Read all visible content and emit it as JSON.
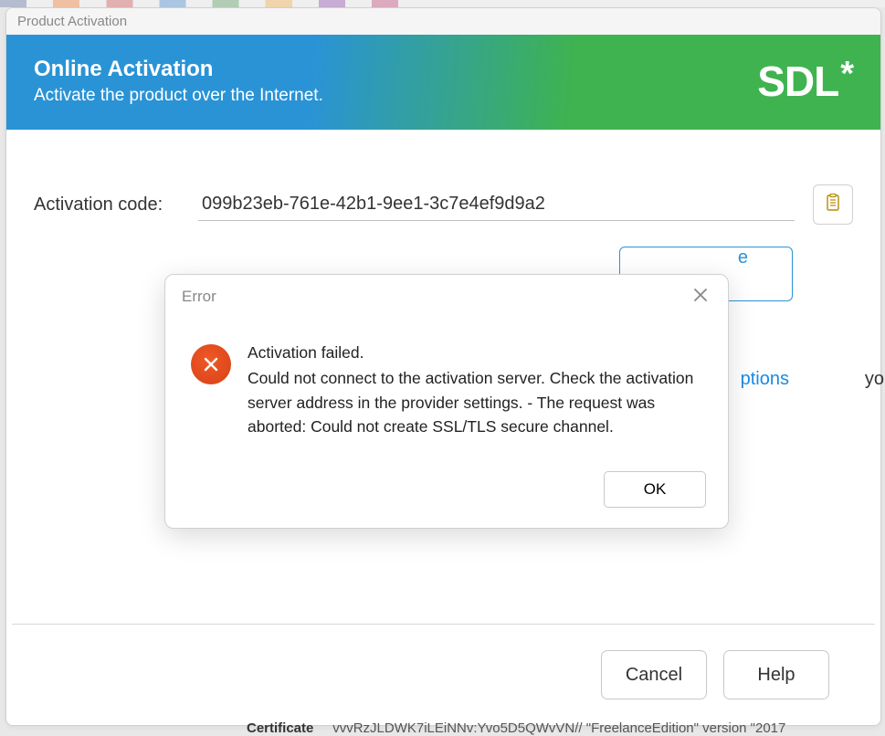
{
  "window": {
    "title": "Product Activation"
  },
  "header": {
    "title": "Online Activation",
    "subtitle": "Activate the product over the Internet.",
    "logo_text": "SDL",
    "logo_mark": "*"
  },
  "form": {
    "activation_label": "Activation code:",
    "activation_value": "099b23eb-761e-42b1-9ee1-3c7e4ef9d9a2",
    "paste_icon": "clipboard-icon",
    "activate_partial_text": "e",
    "link_partial_text": "ptions",
    "cropped_right_text": "yo"
  },
  "footer": {
    "cancel_label": "Cancel",
    "help_label": "Help"
  },
  "bottom_strip": {
    "label": "Certificate",
    "snippet": "vvvRzJLDWK7iLEiNNv:Yvo5D5QWvVN// \"FreelanceEdition\" version \"2017"
  },
  "error_dialog": {
    "title": "Error",
    "headline": "Activation failed.",
    "message": "Could not connect to the activation server. Check the activation server address in the provider settings. - The request was aborted: Could not create SSL/TLS secure channel.",
    "ok_label": "OK"
  }
}
